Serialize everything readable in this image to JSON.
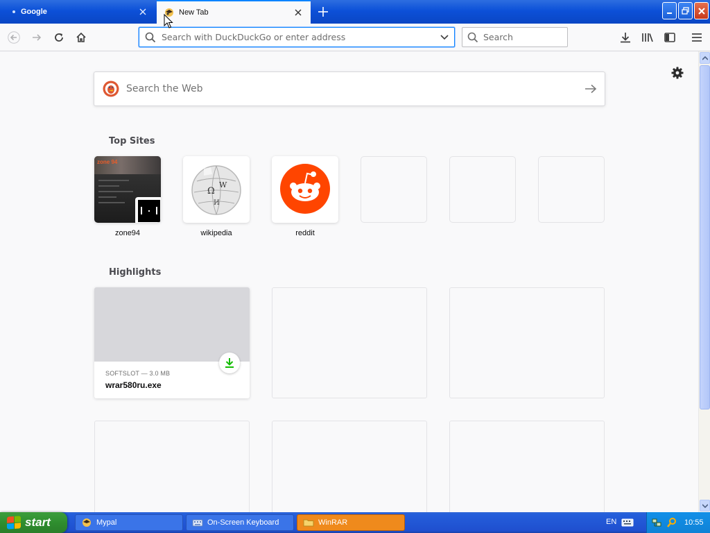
{
  "tabs": [
    {
      "label": "Google"
    },
    {
      "label": "New Tab"
    }
  ],
  "nav": {
    "url_placeholder": "Search with DuckDuckGo or enter address",
    "search_placeholder": "Search"
  },
  "newtab": {
    "web_search_placeholder": "Search the Web",
    "top_sites_title": "Top Sites",
    "top_sites": [
      {
        "label": "zone94"
      },
      {
        "label": "wikipedia"
      },
      {
        "label": "reddit"
      }
    ],
    "highlights_title": "Highlights",
    "highlight": {
      "meta": "SOFTSLOT — 3.0 MB",
      "filename": "wrar580ru.exe"
    }
  },
  "taskbar": {
    "start_label": "start",
    "tasks": [
      {
        "label": "Mypal"
      },
      {
        "label": "On-Screen Keyboard"
      },
      {
        "label": "WinRAR"
      }
    ],
    "language": "EN",
    "clock": "10:55"
  },
  "colors": {
    "accent": "#0a84ff",
    "reddit": "#ff4500",
    "download_green": "#12bc00",
    "titlebar_blue": "#0c50d8"
  }
}
